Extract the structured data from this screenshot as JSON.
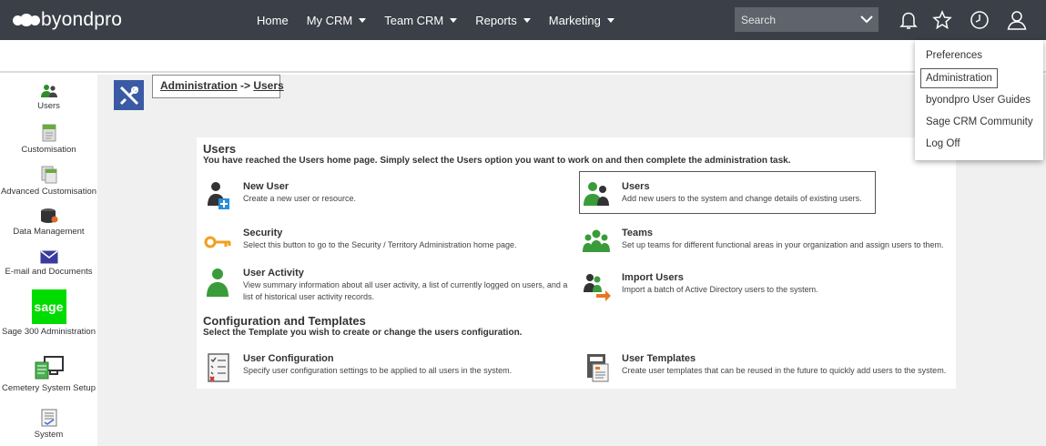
{
  "brand": {
    "name": "byondpro"
  },
  "nav": [
    {
      "label": "Home",
      "caret": false
    },
    {
      "label": "My CRM",
      "caret": true
    },
    {
      "label": "Team CRM",
      "caret": true
    },
    {
      "label": "Reports",
      "caret": true
    },
    {
      "label": "Marketing",
      "caret": true
    }
  ],
  "search": {
    "placeholder": "Search"
  },
  "toolbar_icons": [
    "bell-icon",
    "star-icon",
    "clock-icon",
    "user-icon"
  ],
  "sidebar": {
    "items": [
      {
        "label": "Users",
        "icon": "users-icon"
      },
      {
        "label": "Customisation",
        "icon": "document-icon"
      },
      {
        "label": "Advanced Customisation",
        "icon": "documents-icon"
      },
      {
        "label": "Data Management",
        "icon": "database-icon"
      },
      {
        "label": "E-mail and Documents",
        "icon": "envelope-icon"
      },
      {
        "label": "Sage 300 Administration",
        "icon": "sage-logo",
        "logo_text": "sage"
      },
      {
        "label": "Cemetery System Setup",
        "icon": "computer-icon"
      },
      {
        "label": "System",
        "icon": "system-icon"
      }
    ]
  },
  "breadcrumb": {
    "part1": "Administration",
    "separator": " -> ",
    "part2": "Users"
  },
  "users_section": {
    "title": "Users",
    "description": "You have reached the Users home page. Simply select the Users option you want to work on and then complete the administration task."
  },
  "options": {
    "new_user": {
      "title": "New User",
      "description": "Create a new user or resource."
    },
    "users": {
      "title": "Users",
      "description": "Add new users to the system and change details of existing users."
    },
    "security": {
      "title": "Security",
      "description": "Select this button to go to the Security / Territory Administration home page."
    },
    "teams": {
      "title": "Teams",
      "description": "Set up teams for different functional areas in your organization and assign users to them."
    },
    "user_activity": {
      "title": "User Activity",
      "description": "View summary information about all user activity, a list of currently logged on users, and a list of historical user activity records."
    },
    "import_users": {
      "title": "Import Users",
      "description": "Import a batch of Active Directory users to the system."
    },
    "user_configuration": {
      "title": "User Configuration",
      "description": "Specify user configuration settings to be applied to all users in the system."
    },
    "user_templates": {
      "title": "User Templates",
      "description": "Create user templates that can be reused in the future to quickly add users to the system."
    }
  },
  "config_section": {
    "title": "Configuration and Templates",
    "description": "Select the Template you wish to create or change the users configuration."
  },
  "user_menu": {
    "items": [
      {
        "label": "Preferences",
        "selected": false
      },
      {
        "label": "Administration",
        "selected": true
      },
      {
        "label": "byondpro User Guides",
        "selected": false
      },
      {
        "label": "Sage CRM Community",
        "selected": false
      },
      {
        "label": "Log Off",
        "selected": false
      }
    ]
  },
  "colors": {
    "topbar": "#3b3f47",
    "accent_green": "#3a9b3a",
    "admin_blue": "#3b5aa4",
    "sage_green": "#00dc00",
    "content_bg": "#f0f0f0"
  }
}
